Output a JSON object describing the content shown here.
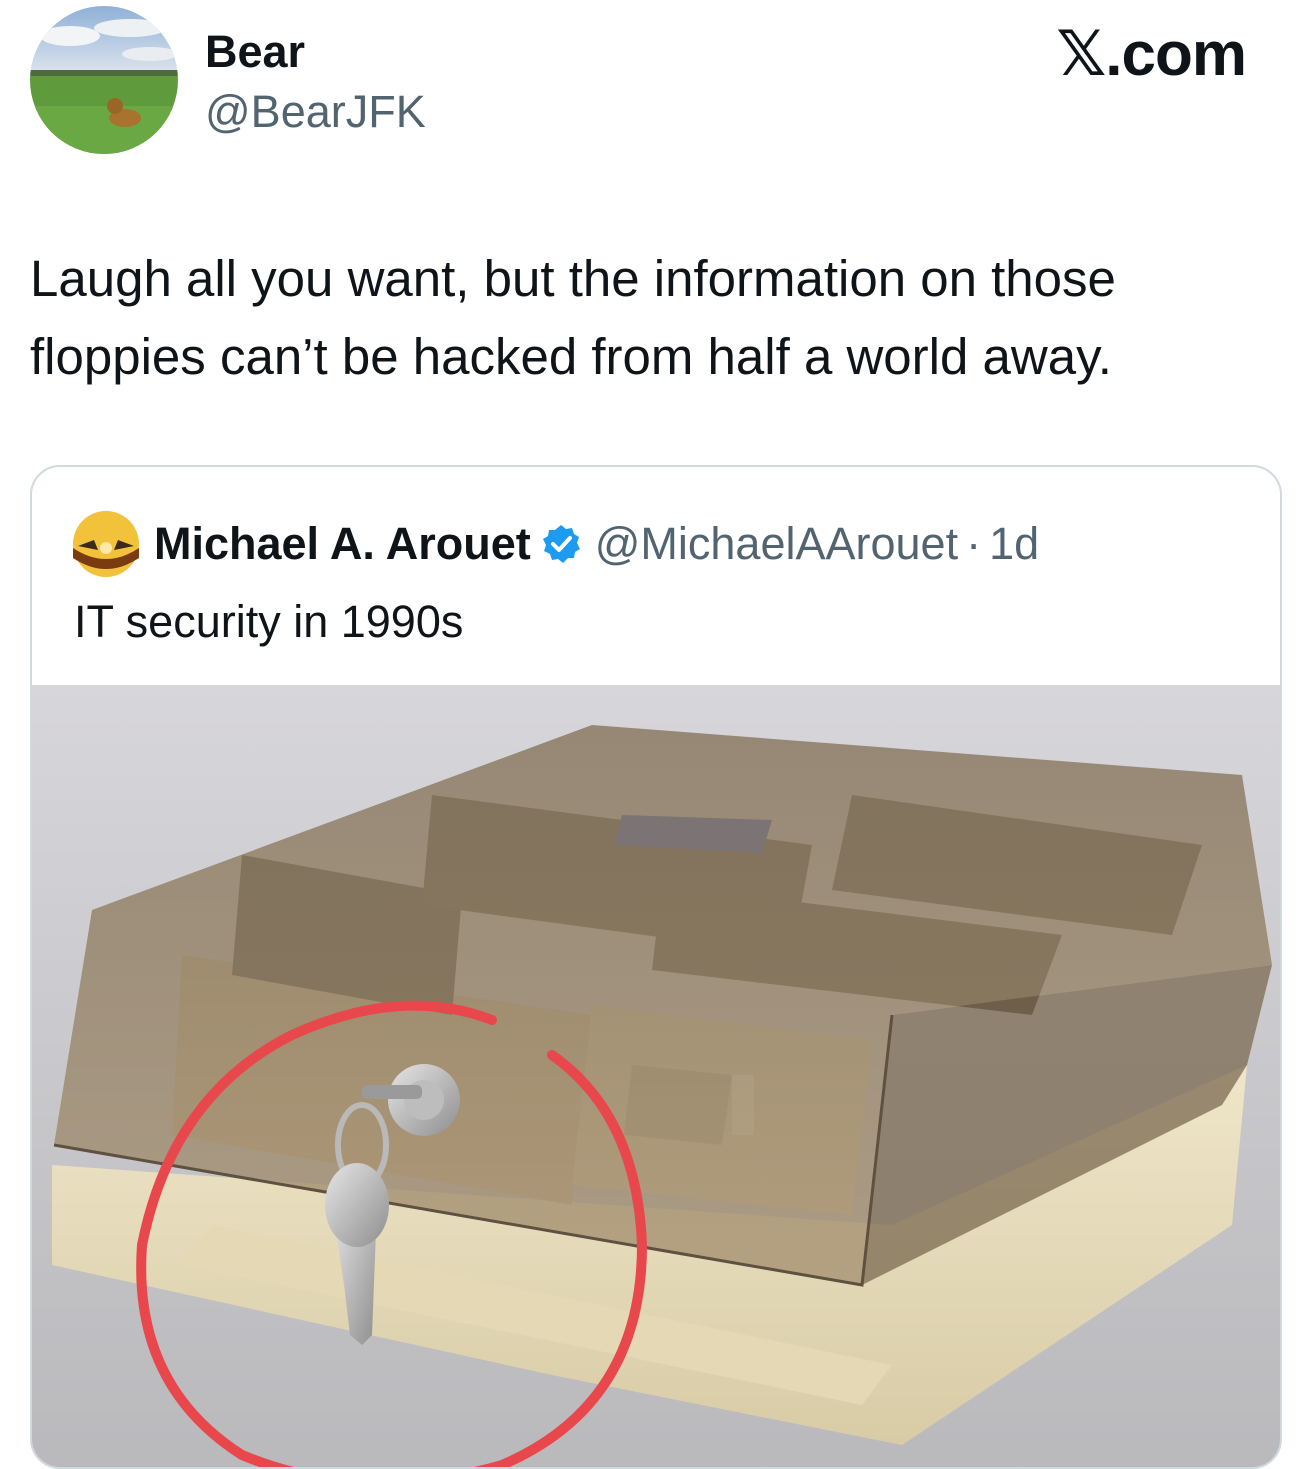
{
  "author": {
    "name": "Bear",
    "handle": "@BearJFK",
    "avatar_icon": "profile-photo-dog-in-field"
  },
  "site_mark": "𝕏.com",
  "tweet": {
    "text": "Laugh all you want, but the information on those floppies can’t be hacked from half a world away."
  },
  "quote": {
    "author_name": "Michael A. Arouet",
    "verified_icon": "verified-badge-icon",
    "verified_color": "#1d9bf0",
    "handle": "@MichaelAArouet",
    "separator": "·",
    "time": "1d",
    "text": "IT security in 1990s",
    "media": {
      "description_icon": "locked-floppy-disk-storage-box-photo",
      "highlight_color": "#e8474c"
    }
  },
  "colors": {
    "text": "#0f1419",
    "secondary_text": "#536471",
    "card_border": "#cfd9de"
  }
}
